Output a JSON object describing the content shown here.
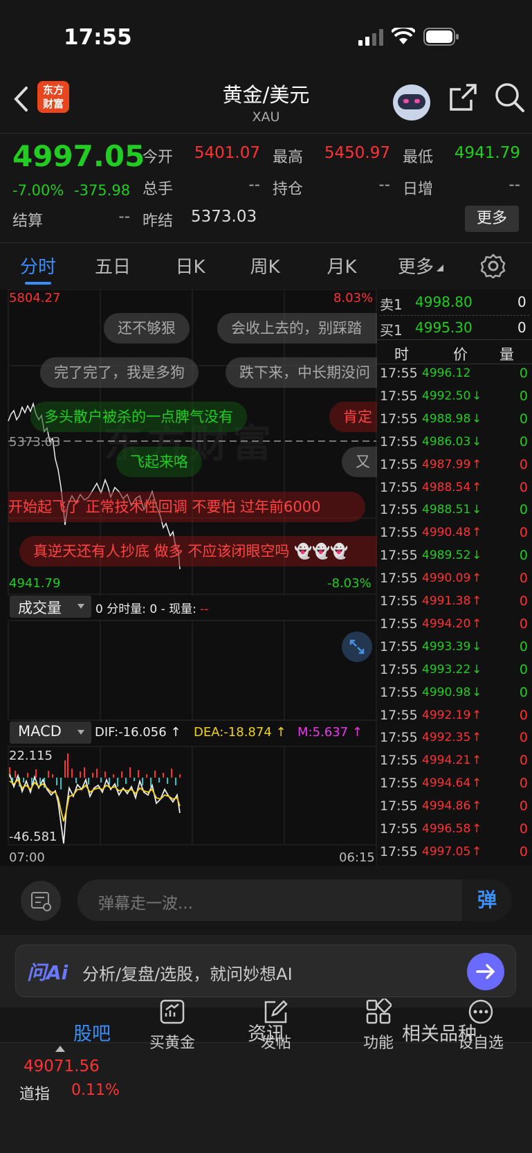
{
  "status": {
    "time": "17:55"
  },
  "nav": {
    "logo_line1": "东方",
    "logo_line2": "财富",
    "title": "黄金/美元",
    "subtitle": "XAU"
  },
  "quote": {
    "price": "4997.05",
    "pct": "-7.00%",
    "chg": "-375.98",
    "open_label": "今开",
    "open": "5401.07",
    "high_label": "最高",
    "high": "5450.97",
    "low_label": "最低",
    "low": "4941.79",
    "vol_label": "总手",
    "vol": "--",
    "oi_label": "持仓",
    "oi": "--",
    "daily_label": "日增",
    "daily": "--",
    "settle_label": "结算",
    "settle": "--",
    "prev_label": "昨结",
    "prev": "5373.03",
    "more": "更多"
  },
  "tabs": [
    "分时",
    "五日",
    "日K",
    "周K",
    "月K",
    "更多"
  ],
  "chart": {
    "top_price": "5804.27",
    "top_pct": "8.03%",
    "mid_price": "5373.03",
    "bottom_price": "4941.79",
    "bottom_pct": "-8.03%",
    "watermark": "东方财富",
    "vol_label": "成交量",
    "vol_info": "0 分时量: 0 - 现量: ",
    "vol_dash": "--",
    "macd_label": "MACD",
    "dif": "DIF:-16.056 ↑",
    "dea": "DEA:-18.874 ↑",
    "m": "M:5.637 ↑",
    "macd_top": "22.115",
    "macd_bottom": "-46.581",
    "time_start": "07:00",
    "time_end": "06:15"
  },
  "danmaku": [
    "还不够狠",
    "会收上去的，别踩踏",
    "完了完了，我是多狗",
    "跌下来，中长期没问",
    "多头散户被杀的一点脾气没有",
    "肯定",
    "飞起来咯",
    "又",
    "开始起飞了 正常技术性回调 不要怕 过年前6000",
    "真逆天还有人抄底 做多 不应该闭眼空吗"
  ],
  "orderbook": {
    "sell_label": "卖1",
    "sell_price": "4998.80",
    "sell_vol": "0",
    "buy_label": "买1",
    "buy_price": "4995.30",
    "buy_vol": "0",
    "h_time": "时",
    "h_price": "价",
    "h_vol": "量"
  },
  "ticks": [
    {
      "t": "17:55",
      "p": "4996.12",
      "a": "",
      "v": "0",
      "c": "#22cc22"
    },
    {
      "t": "17:55",
      "p": "4992.50",
      "a": "↓",
      "v": "0",
      "c": "#22cc22"
    },
    {
      "t": "17:55",
      "p": "4988.98",
      "a": "↓",
      "v": "0",
      "c": "#22cc22"
    },
    {
      "t": "17:55",
      "p": "4986.03",
      "a": "↓",
      "v": "0",
      "c": "#22cc22"
    },
    {
      "t": "17:55",
      "p": "4987.99",
      "a": "↑",
      "v": "0",
      "c": "#ff3333"
    },
    {
      "t": "17:55",
      "p": "4988.54",
      "a": "↑",
      "v": "0",
      "c": "#ff3333"
    },
    {
      "t": "17:55",
      "p": "4988.51",
      "a": "↓",
      "v": "0",
      "c": "#22cc22"
    },
    {
      "t": "17:55",
      "p": "4990.48",
      "a": "↑",
      "v": "0",
      "c": "#ff3333"
    },
    {
      "t": "17:55",
      "p": "4989.52",
      "a": "↓",
      "v": "0",
      "c": "#22cc22"
    },
    {
      "t": "17:55",
      "p": "4990.09",
      "a": "↑",
      "v": "0",
      "c": "#ff3333"
    },
    {
      "t": "17:55",
      "p": "4991.38",
      "a": "↑",
      "v": "0",
      "c": "#ff3333"
    },
    {
      "t": "17:55",
      "p": "4994.20",
      "a": "↑",
      "v": "0",
      "c": "#ff3333"
    },
    {
      "t": "17:55",
      "p": "4993.39",
      "a": "↓",
      "v": "0",
      "c": "#22cc22"
    },
    {
      "t": "17:55",
      "p": "4993.22",
      "a": "↓",
      "v": "0",
      "c": "#22cc22"
    },
    {
      "t": "17:55",
      "p": "4990.98",
      "a": "↓",
      "v": "0",
      "c": "#22cc22"
    },
    {
      "t": "17:55",
      "p": "4992.19",
      "a": "↑",
      "v": "0",
      "c": "#ff3333"
    },
    {
      "t": "17:55",
      "p": "4992.35",
      "a": "↑",
      "v": "0",
      "c": "#ff3333"
    },
    {
      "t": "17:55",
      "p": "4994.21",
      "a": "↑",
      "v": "0",
      "c": "#ff3333"
    },
    {
      "t": "17:55",
      "p": "4994.64",
      "a": "↑",
      "v": "0",
      "c": "#ff3333"
    },
    {
      "t": "17:55",
      "p": "4994.86",
      "a": "↑",
      "v": "0",
      "c": "#ff3333"
    },
    {
      "t": "17:55",
      "p": "4996.58",
      "a": "↑",
      "v": "0",
      "c": "#ff3333"
    },
    {
      "t": "17:55",
      "p": "4997.05",
      "a": "↑",
      "v": "0",
      "c": "#ff3333"
    }
  ],
  "comment": {
    "placeholder": "弹幕走一波...",
    "danmu_btn": "弹"
  },
  "ai": {
    "logo": "问Ai",
    "placeholder": "分析/复盘/选股，就问妙想AI"
  },
  "subtabs": [
    "股吧",
    "资讯",
    "相关品种"
  ],
  "bottom": {
    "index_value": "49071.56",
    "index_name": "道指",
    "index_pct": "0.11%",
    "items": [
      "买黄金",
      "发帖",
      "功能",
      "设自选"
    ]
  },
  "colors": {
    "up": "#ff3333",
    "down": "#22cc22",
    "accent": "#3a8dff",
    "bg": "#161616"
  }
}
